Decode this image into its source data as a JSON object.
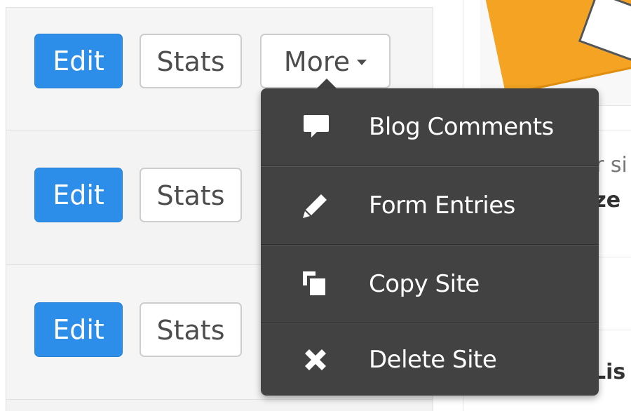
{
  "site_rows": [
    {
      "edit_label": "Edit",
      "stats_label": "Stats",
      "more_label": "More"
    },
    {
      "edit_label": "Edit",
      "stats_label": "Stats"
    },
    {
      "edit_label": "Edit",
      "stats_label": "Stats"
    }
  ],
  "right_panel": {
    "snippet_1": "r si",
    "snippet_2": "ize",
    "snippet_3": "Lis"
  },
  "more_menu": {
    "items": [
      {
        "label": "Blog Comments",
        "icon": "speech-bubble-icon"
      },
      {
        "label": "Form Entries",
        "icon": "pencil-icon"
      },
      {
        "label": "Copy Site",
        "icon": "copy-icon"
      },
      {
        "label": "Delete Site",
        "icon": "x-icon"
      }
    ]
  },
  "colors": {
    "primary": "#2d8eea",
    "menu_bg": "#424242",
    "thumbnail_accent": "#f4a322"
  }
}
